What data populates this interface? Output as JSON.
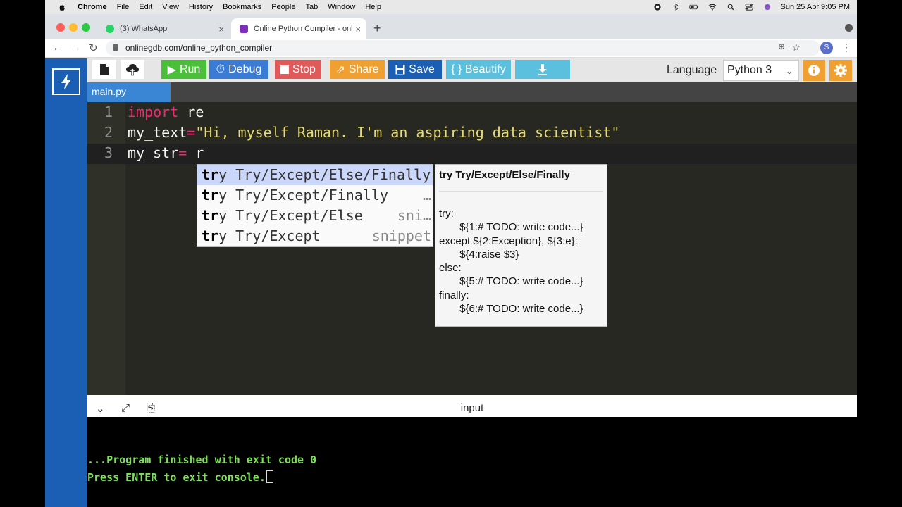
{
  "menubar": {
    "app": "Chrome",
    "items": [
      "File",
      "Edit",
      "View",
      "History",
      "Bookmarks",
      "People",
      "Tab",
      "Window",
      "Help"
    ],
    "datetime": "Sun 25 Apr  9:05 PM"
  },
  "browser": {
    "tabs": [
      {
        "title": "(3) WhatsApp",
        "icon": "whatsapp-icon"
      },
      {
        "title": "Online Python Compiler - onlin",
        "icon": "onlinegdb-icon"
      }
    ],
    "url": "onlinegdb.com/online_python_compiler",
    "profile_initial": "S"
  },
  "toolbar": {
    "run": "Run",
    "debug": "Debug",
    "stop": "Stop",
    "share": "Share",
    "save": "Save",
    "beautify": "{ } Beautify",
    "language_label": "Language",
    "language_value": "Python 3"
  },
  "colors": {
    "run": "#4bbf3a",
    "debug": "#3a7bd5",
    "stop": "#e05a5a",
    "share": "#f0a030",
    "save": "#1a5fb4",
    "beautify": "#5bc0de",
    "download": "#5bc0de"
  },
  "file_tab": "main.py",
  "editor": {
    "line_numbers": [
      "1",
      "2",
      "3"
    ],
    "line1_kw": "import",
    "line1_rest": " re",
    "line2_var": "my_text",
    "line2_op": "=",
    "line2_str": "\"Hi, myself Raman. I'm an aspiring data scientist\"",
    "line3_var": "my_str",
    "line3_op": "=",
    "line3_rest": " r"
  },
  "autocomplete": {
    "items": [
      {
        "match": "tr",
        "rest": "y Try/Except/Else/Finally",
        "meta": ""
      },
      {
        "match": "tr",
        "rest": "y Try/Except/Finally",
        "meta": "…"
      },
      {
        "match": "tr",
        "rest": "y Try/Except/Else",
        "meta": "sni…"
      },
      {
        "match": "tr",
        "rest": "y Try/Except",
        "meta": "snippet"
      }
    ],
    "doc_title": "try Try/Except/Else/Finally",
    "doc_body": "try:\n       ${1:# TODO: write code...}\nexcept ${2:Exception}, ${3:e}:\n       ${4:raise $3}\nelse:\n       ${5:# TODO: write code...}\nfinally:\n       ${6:# TODO: write code...}"
  },
  "console": {
    "label": "input",
    "line1": "...Program finished with exit code 0",
    "line2": "Press ENTER to exit console."
  }
}
